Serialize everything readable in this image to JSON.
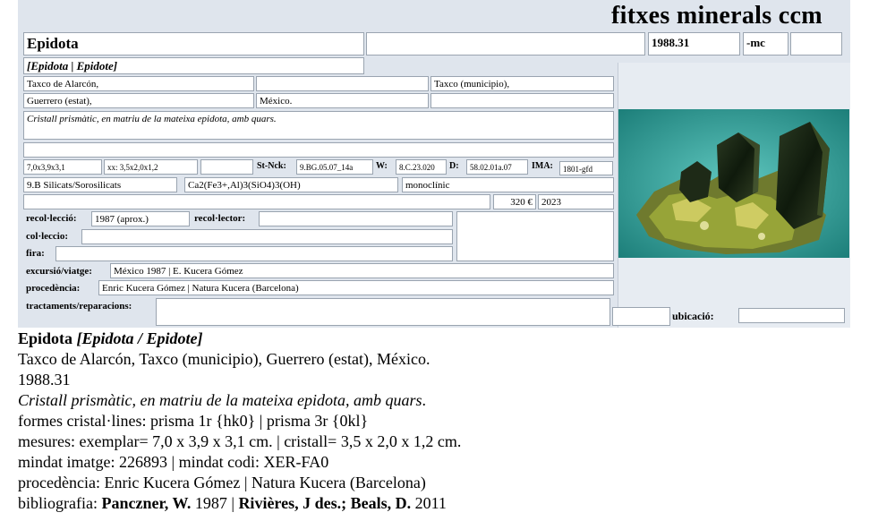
{
  "header": {
    "title": "fitxes minerals ccm"
  },
  "card": {
    "name": "Epidota",
    "box_blank1": "",
    "number": "1988.31",
    "suffix": "-mc",
    "box_blank2": "",
    "synonyms": "[Epidota | Epidote]",
    "loc1": "Taxco de Alarcón,",
    "loc2": "",
    "loc3": "Taxco (municipio),",
    "loc4": "Guerrero (estat),",
    "loc5": "México.",
    "loc6": "",
    "description": "Cristall prismàtic, en matriu de la mateixa epidota, amb quars.",
    "blank_line": "",
    "size_specimen": "7,0x3,9x3,1",
    "size_crystal": "xx: 3,5x2,0x1,2",
    "size_blank": "",
    "stnck_label": "St-Nck:",
    "stnck_value": "9.BG.05.07_14a",
    "w_label": "W:",
    "w_value": "8.C.23.020",
    "d_label": "D:",
    "d_value": "58.02.01a.07",
    "ima_label": "IMA:",
    "ima_value": "1801-gfd",
    "class": "9.B Silicats/Sorosilicats",
    "formula": "Ca2(Fe3+,Al)3(SiO4)3(OH)",
    "system": "monoclínic",
    "price_blank": "",
    "price": "320 €",
    "year": "2023",
    "collection_label": "recol·lecció:",
    "collection_value": "1987 (aprox.)",
    "collector_label": "recol·lector:",
    "collector_value": "",
    "col_label": "col·leccio:",
    "col_value": "",
    "fair_label": "fira:",
    "fair_value": "",
    "trip_label": "excursió/viatge:",
    "trip_value": "México 1987 | E. Kucera Gómez",
    "source_label": "procedència:",
    "source_value": "Enric Kucera Gómez | Natura Kucera (Barcelona)",
    "treatments_label": "tractaments/reparacions:",
    "treatments_value": "",
    "location_blank": "",
    "location_label": "ubicació:",
    "location_value": ""
  },
  "summary": {
    "name": "Epidota",
    "synonyms": "[Epidota / Epidote]",
    "locality": "Taxco de Alarcón, Taxco (municipio), Guerrero (estat), México.",
    "number": "1988.31",
    "description": "Cristall prismàtic, en matriu de la mateixa epidota, amb quars",
    "description_end": ".",
    "forms": "formes cristal·lines: prisma 1r {hk0} | prisma 3r {0kl}",
    "measures": "mesures: exemplar= 7,0 x 3,9 x 3,1 cm. | cristall= 3,5 x 2,0 x 1,2 cm.",
    "mindat": "mindat imatge: 226893 | mindat codi: XER-FA0",
    "source": "procedència: Enric Kucera Gómez | Natura Kucera (Barcelona)",
    "biblio_prefix": "bibliografia: ",
    "biblio_author1": "Panczner, W.",
    "biblio_year1": " 1987 | ",
    "biblio_author2": "Rivières, J des.; Beals, D.",
    "biblio_year2": " 2011"
  },
  "colors": {
    "card_bg": "#dfe5ed",
    "field_bg": "#ffffff",
    "field_border": "#9aa4b0"
  },
  "photo": {
    "icon": "mineral-photo",
    "subject": "dark green epidote crystal with quartz on matrix"
  }
}
